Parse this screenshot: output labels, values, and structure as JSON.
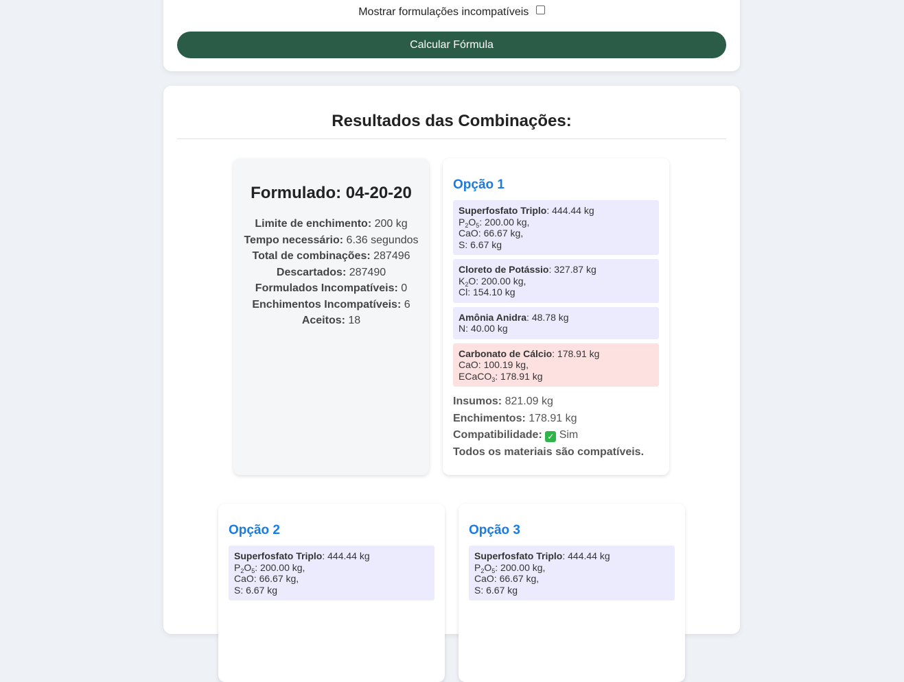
{
  "form": {
    "incompatible_toggle_label": "Mostrar formulações incompatíveis",
    "incompatible_toggle_checked": false,
    "calculate_button_label": "Calcular Fórmula"
  },
  "results": {
    "title": "Resultados das Combinações:",
    "summary": {
      "title": "Formulado: 04-20-20",
      "stats": [
        {
          "label": "Limite de enchimento:",
          "value": "200 kg"
        },
        {
          "label": "Tempo necessário:",
          "value": "6.36 segundos"
        },
        {
          "label": "Total de combinações:",
          "value": "287496"
        },
        {
          "label": "Descartados:",
          "value": "287490"
        },
        {
          "label": "Formulados Incompatíveis:",
          "value": "0"
        },
        {
          "label": "Enchimentos Incompatíveis:",
          "value": "6"
        },
        {
          "label": "Aceitos:",
          "value": "18"
        }
      ]
    },
    "options": [
      {
        "title": "Opção 1",
        "materials": [
          {
            "name": "Superfosfato Triplo",
            "amount": ": 444.44 kg",
            "nutrients": [
              {
                "symbol": "P",
                "s1": "2",
                "mid": "O",
                "s2": "5",
                "value": ": 200.00 kg,"
              },
              {
                "symbol": "CaO",
                "s1": "",
                "mid": "",
                "s2": "",
                "value": ": 66.67 kg,"
              },
              {
                "symbol": "S",
                "s1": "",
                "mid": "",
                "s2": "",
                "value": ": 6.67 kg"
              }
            ]
          },
          {
            "name": "Cloreto de Potássio",
            "amount": ": 327.87 kg",
            "nutrients": [
              {
                "symbol": "K",
                "s1": "2",
                "mid": "O",
                "s2": "",
                "value": ": 200.00 kg,"
              },
              {
                "symbol": "Cl",
                "s1": "",
                "mid": "",
                "s2": "",
                "value": ": 154.10 kg"
              }
            ]
          },
          {
            "name": "Amônia Anidra",
            "amount": ": 48.78 kg",
            "nutrients": [
              {
                "symbol": "N",
                "s1": "",
                "mid": "",
                "s2": "",
                "value": ": 40.00 kg"
              }
            ]
          },
          {
            "name": "Carbonato de Cálcio",
            "amount": ": 178.91 kg",
            "filler": true,
            "nutrients": [
              {
                "symbol": "CaO",
                "s1": "",
                "mid": "",
                "s2": "",
                "value": ": 100.19 kg,"
              },
              {
                "symbol": "ECaCO",
                "s1": "3",
                "mid": "",
                "s2": "",
                "value": ": 178.91 kg"
              }
            ]
          }
        ],
        "insumos_label": "Insumos:",
        "insumos_value": "821.09 kg",
        "enchimentos_label": "Enchimentos:",
        "enchimentos_value": "178.91 kg",
        "compat_label": "Compatibilidade:",
        "compat_icon": "✓",
        "compat_value": "Sim",
        "compat_note": "Todos os materiais são compatíveis."
      },
      {
        "title": "Opção 2",
        "materials": [
          {
            "name": "Superfosfato Triplo",
            "amount": ": 444.44 kg",
            "nutrients": [
              {
                "symbol": "P",
                "s1": "2",
                "mid": "O",
                "s2": "5",
                "value": ": 200.00 kg,"
              },
              {
                "symbol": "CaO",
                "s1": "",
                "mid": "",
                "s2": "",
                "value": ": 66.67 kg,"
              },
              {
                "symbol": "S",
                "s1": "",
                "mid": "",
                "s2": "",
                "value": ": 6.67 kg"
              }
            ]
          }
        ]
      },
      {
        "title": "Opção 3",
        "materials": [
          {
            "name": "Superfosfato Triplo",
            "amount": ": 444.44 kg",
            "nutrients": [
              {
                "symbol": "P",
                "s1": "2",
                "mid": "O",
                "s2": "5",
                "value": ": 200.00 kg,"
              },
              {
                "symbol": "CaO",
                "s1": "",
                "mid": "",
                "s2": "",
                "value": ": 66.67 kg,"
              },
              {
                "symbol": "S",
                "s1": "",
                "mid": "",
                "s2": "",
                "value": ": 6.67 kg"
              }
            ]
          }
        ]
      }
    ]
  }
}
